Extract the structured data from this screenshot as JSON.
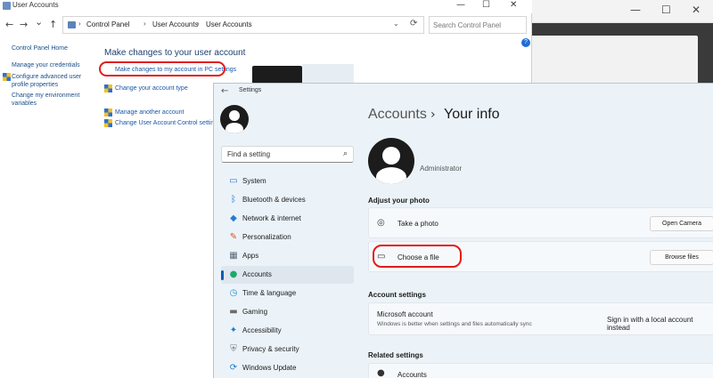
{
  "background_window": {
    "controls": [
      "—",
      "☐",
      "✕"
    ]
  },
  "control_panel": {
    "title": "User Accounts",
    "controls": [
      "—",
      "☐",
      "✕"
    ],
    "nav_buttons": [
      "←",
      "→",
      "⌄",
      "↑"
    ],
    "refresh": "⟳",
    "breadcrumb": [
      "Control Panel",
      "User Accounts",
      "User Accounts"
    ],
    "breadcrumb_sep": "›",
    "search_placeholder": "Search Control Panel",
    "help": "?",
    "left_links": [
      "Control Panel Home",
      "Manage your credentials",
      "Configure advanced user profile properties",
      "Change my environment variables"
    ],
    "heading": "Make changes to your user account",
    "links": [
      "Make changes to my account in PC settings",
      "Change your account type",
      "Manage another account",
      "Change User Account Control settings"
    ],
    "colors": {
      "link": "#1a56a6",
      "heading": "#1b3f6e",
      "highlight": "#e21b1b"
    }
  },
  "settings": {
    "title": "Settings",
    "back": "←",
    "find_placeholder": "Find a setting",
    "nav": [
      {
        "label": "System",
        "icon": "monitor-icon",
        "glyph": "▭",
        "color": "#2b78d4"
      },
      {
        "label": "Bluetooth & devices",
        "icon": "bluetooth-icon",
        "glyph": "ᛒ",
        "color": "#1573d1"
      },
      {
        "label": "Network & internet",
        "icon": "wifi-icon",
        "glyph": "◆",
        "color": "#2b78d4"
      },
      {
        "label": "Personalization",
        "icon": "brush-icon",
        "glyph": "✎",
        "color": "#d9531e"
      },
      {
        "label": "Apps",
        "icon": "apps-icon",
        "glyph": "▦",
        "color": "#5a6a7a"
      },
      {
        "label": "Accounts",
        "icon": "person-icon",
        "glyph": "●",
        "color": "#1fa86b"
      },
      {
        "label": "Time & language",
        "icon": "globe-icon",
        "glyph": "◷",
        "color": "#1c8fd6"
      },
      {
        "label": "Gaming",
        "icon": "gamepad-icon",
        "glyph": "▬",
        "color": "#6b6b6b"
      },
      {
        "label": "Accessibility",
        "icon": "accessibility-icon",
        "glyph": "✦",
        "color": "#1b7bd2"
      },
      {
        "label": "Privacy & security",
        "icon": "shield-icon",
        "glyph": "⛨",
        "color": "#7a7a7a"
      },
      {
        "label": "Windows Update",
        "icon": "update-icon",
        "glyph": "⟳",
        "color": "#1b7bd2"
      }
    ],
    "active_nav": "Accounts",
    "breadcrumb": {
      "parent": "Accounts",
      "sep": "›",
      "current": "Your info"
    },
    "user_name": "Administrator",
    "adjust_photo": {
      "heading": "Adjust your photo",
      "take_photo": {
        "label": "Take a photo",
        "button": "Open Camera"
      },
      "choose_file": {
        "label": "Choose a file",
        "button": "Browse files"
      }
    },
    "account_settings": {
      "heading": "Account settings",
      "microsoft_account": {
        "title": "Microsoft account",
        "desc": "Windows is better when settings and files automatically sync",
        "action": "Sign in with a local account instead"
      }
    },
    "related_settings": {
      "heading": "Related settings",
      "accounts": "Accounts"
    },
    "colors": {
      "accent": "#005fb8",
      "window_bg": "#ecf3f8"
    }
  }
}
